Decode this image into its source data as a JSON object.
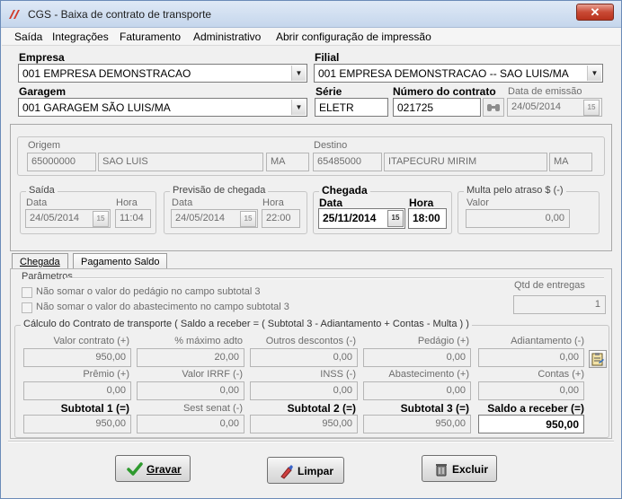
{
  "window": {
    "title": "CGS - Baixa de contrato de transporte",
    "close_glyph": "✕"
  },
  "menu": [
    "Saída",
    "Integrações",
    "Faturamento",
    "Administrativo",
    "Abrir configuração de impressão"
  ],
  "header": {
    "empresa_label": "Empresa",
    "empresa_value": "001 EMPRESA DEMONSTRACAO",
    "filial_label": "Filial",
    "filial_value": "001 EMPRESA DEMONSTRACAO -- SAO LUIS/MA",
    "garagem_label": "Garagem",
    "garagem_value": "001 GARAGEM SÃO LUIS/MA",
    "serie_label": "Série",
    "serie_value": "ELETR",
    "numero_label": "Número do contrato",
    "numero_value": "021725",
    "emissao_label": "Data de emissão",
    "emissao_value": "24/05/2014"
  },
  "route": {
    "origem_label": "Origem",
    "origem_cep": "65000000",
    "origem_cidade": "SAO LUIS",
    "origem_uf": "MA",
    "destino_label": "Destino",
    "destino_cep": "65485000",
    "destino_cidade": "ITAPECURU MIRIM",
    "destino_uf": "MA"
  },
  "saida": {
    "title": "Saída",
    "data_label": "Data",
    "hora_label": "Hora",
    "data": "24/05/2014",
    "hora": "11:04"
  },
  "previsao": {
    "title": "Previsão de chegada",
    "data_label": "Data",
    "hora_label": "Hora",
    "data": "24/05/2014",
    "hora": "22:00"
  },
  "chegada": {
    "title": "Chegada",
    "data_label": "Data",
    "hora_label": "Hora",
    "data": "25/11/2014",
    "hora": "18:00"
  },
  "multa": {
    "title": "Multa pelo atraso $ (-)",
    "valor_label": "Valor",
    "valor": "0,00"
  },
  "calendar_glyph": "15",
  "tabs": [
    "Chegada",
    "Pagamento Saldo"
  ],
  "parametros": {
    "title": "Parâmetros",
    "opt1": "Não somar o valor do pedágio no campo subtotal 3",
    "opt2": "Não somar o valor do abastecimento no campo subtotal 3",
    "qtd_label": "Qtd de entregas",
    "qtd_value": "1"
  },
  "calc": {
    "title": "Cálculo do Contrato de transporte ( Saldo a receber = ( Subtotal 3 - Adiantamento + Contas - Multa ) )",
    "rows": [
      [
        {
          "label": "Valor contrato (+)",
          "value": "950,00"
        },
        {
          "label": "% máximo adto",
          "value": "20,00"
        },
        {
          "label": "Outros descontos (-)",
          "value": "0,00"
        },
        {
          "label": "Pedágio (+)",
          "value": "0,00"
        },
        {
          "label": "Adiantamento (-)",
          "value": "0,00"
        }
      ],
      [
        {
          "label": "Prêmio (+)",
          "value": "0,00"
        },
        {
          "label": "Valor IRRF (-)",
          "value": "0,00"
        },
        {
          "label": "INSS (-)",
          "value": "0,00"
        },
        {
          "label": "Abastecimento (+)",
          "value": "0,00"
        },
        {
          "label": "Contas (+)",
          "value": "0,00"
        }
      ],
      [
        {
          "label": "Subtotal 1 (=)",
          "value": "950,00"
        },
        {
          "label": "Sest senat (-)",
          "value": "0,00"
        },
        {
          "label": "Subtotal 2 (=)",
          "value": "950,00"
        },
        {
          "label": "Subtotal 3 (=)",
          "value": "950,00"
        },
        {
          "label": "Saldo a receber (=)",
          "value": "950,00"
        }
      ]
    ]
  },
  "buttons": {
    "gravar": "Gravar",
    "limpar": "Limpar",
    "excluir": "Excluir"
  },
  "colors": {
    "titlebar": "#c5d6ec",
    "close": "#c94a35",
    "gravar_check": "#2e9a2e"
  }
}
